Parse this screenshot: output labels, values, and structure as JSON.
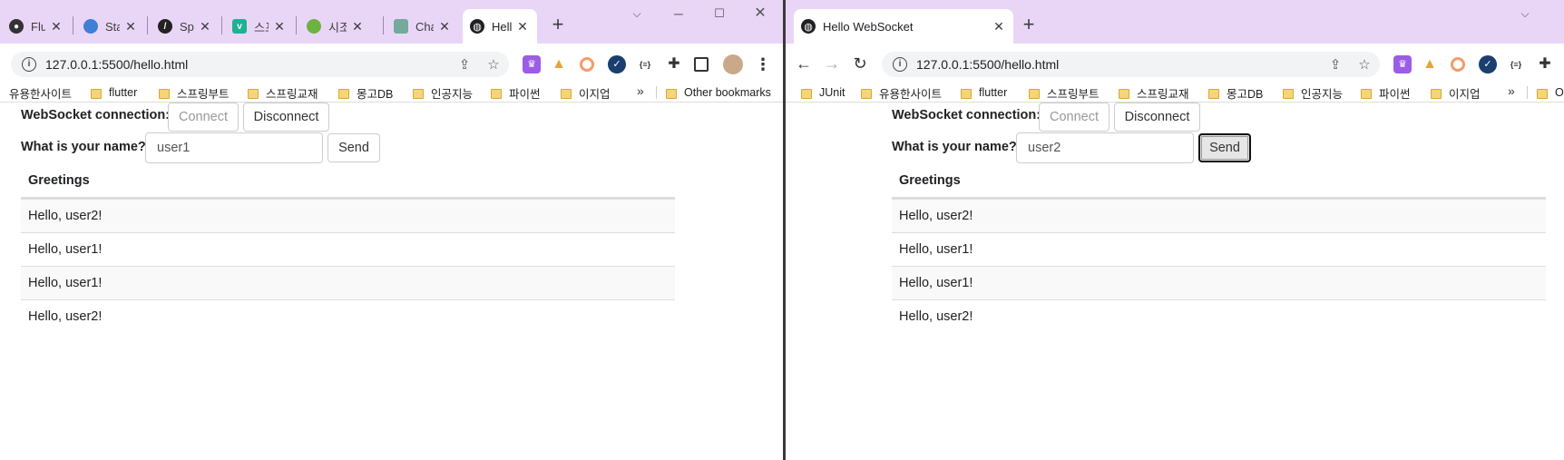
{
  "left": {
    "tabs": [
      {
        "label": "Flut",
        "icon": "github-icon",
        "color": "#333333"
      },
      {
        "label": "Stat",
        "icon": "stats-icon",
        "color": "#3f7fd6"
      },
      {
        "label": "Spri",
        "icon": "spring-slash-icon",
        "color": "#222222"
      },
      {
        "label": "스프",
        "icon": "v-logo-icon",
        "color": "#1bb394"
      },
      {
        "label": "시조",
        "icon": "spring-leaf-icon",
        "color": "#6db33f"
      },
      {
        "label": "Cha",
        "icon": "chatgpt-icon",
        "color": "#74aa9c"
      },
      {
        "label": "Hell",
        "icon": "globe-icon",
        "color": "#202124"
      }
    ],
    "url": "127.0.0.1:5500/hello.html",
    "bookmarks": [
      "유용한사이트",
      "flutter",
      "스프링부트",
      "스프링교재",
      "몽고DB",
      "인공지능",
      "파이썬",
      "이지업"
    ],
    "other_bookmarks": "Other bookmarks",
    "page": {
      "connection_label": "WebSocket connection:",
      "connect_label": "Connect",
      "disconnect_label": "Disconnect",
      "name_label": "What is your name?",
      "name_value": "user1",
      "send_label": "Send",
      "greetings_header": "Greetings",
      "greetings": [
        "Hello, user2!",
        "Hello, user1!",
        "Hello, user1!",
        "Hello, user2!"
      ]
    }
  },
  "right": {
    "tab": {
      "label": "Hello WebSocket",
      "icon": "globe-icon"
    },
    "url": "127.0.0.1:5500/hello.html",
    "bookmarks": [
      "JUnit",
      "유용한사이트",
      "flutter",
      "스프링부트",
      "스프링교재",
      "몽고DB",
      "인공지능",
      "파이썬",
      "이지업"
    ],
    "other_bookmarks_partial": "O",
    "page": {
      "connection_label": "WebSocket connection:",
      "connect_label": "Connect",
      "disconnect_label": "Disconnect",
      "name_label": "What is your name?",
      "name_value": "user2",
      "send_label": "Send",
      "greetings_header": "Greetings",
      "greetings": [
        "Hello, user2!",
        "Hello, user1!",
        "Hello, user1!",
        "Hello, user2!"
      ]
    }
  },
  "colors": {
    "tabstrip": "#e9d6f7",
    "stripe": "#f9f9f9"
  }
}
